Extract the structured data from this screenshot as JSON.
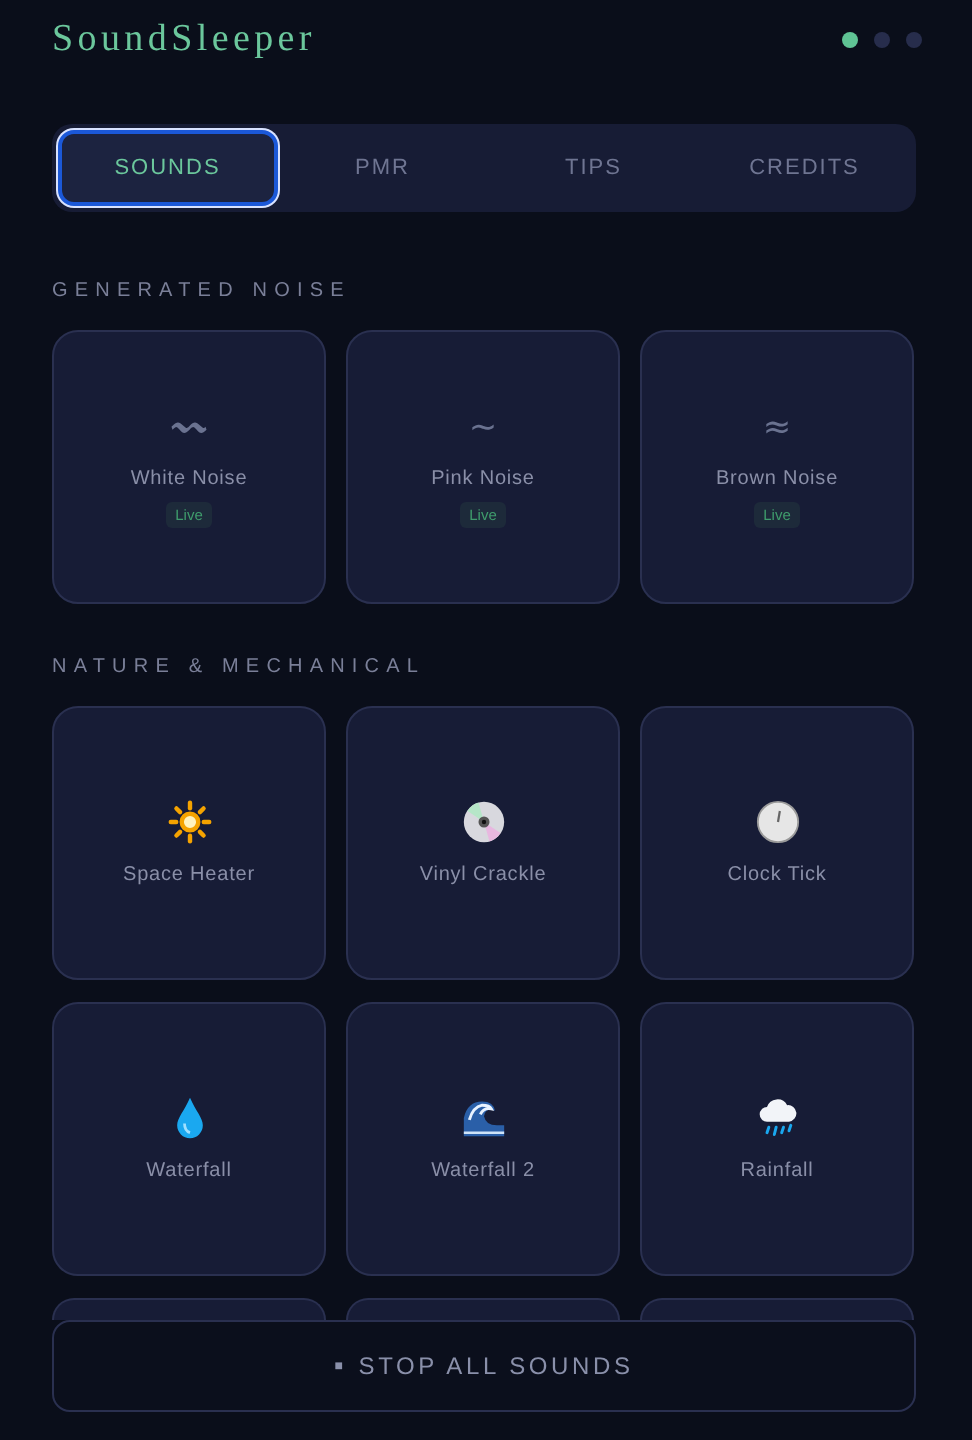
{
  "app_title": "SoundSleeper",
  "page_dots": [
    {
      "selected": true
    },
    {
      "selected": false
    },
    {
      "selected": false
    }
  ],
  "tabs": [
    {
      "label": "SOUNDS",
      "selected": true
    },
    {
      "label": "PMR",
      "selected": false
    },
    {
      "label": "TIPS",
      "selected": false
    },
    {
      "label": "CREDITS",
      "selected": false
    }
  ],
  "sections": [
    {
      "heading": "GENERATED NOISE",
      "sounds": [
        {
          "kind": "glyph",
          "icon": "〰",
          "name": "White Noise",
          "badge": "Live"
        },
        {
          "kind": "glyph",
          "icon": "~",
          "name": "Pink Noise",
          "badge": "Live"
        },
        {
          "kind": "glyph",
          "icon": "≈",
          "name": "Brown Noise",
          "badge": "Live"
        }
      ]
    },
    {
      "heading": "NATURE & MECHANICAL",
      "sounds": [
        {
          "kind": "sun",
          "name": "Space Heater"
        },
        {
          "kind": "disc",
          "name": "Vinyl Crackle"
        },
        {
          "kind": "clock",
          "name": "Clock Tick"
        },
        {
          "kind": "droplet",
          "name": "Waterfall"
        },
        {
          "kind": "wave",
          "name": "Waterfall 2"
        },
        {
          "kind": "rain",
          "name": "Rainfall"
        }
      ]
    }
  ],
  "stop_button": {
    "icon": "■",
    "label": "STOP ALL SOUNDS"
  }
}
